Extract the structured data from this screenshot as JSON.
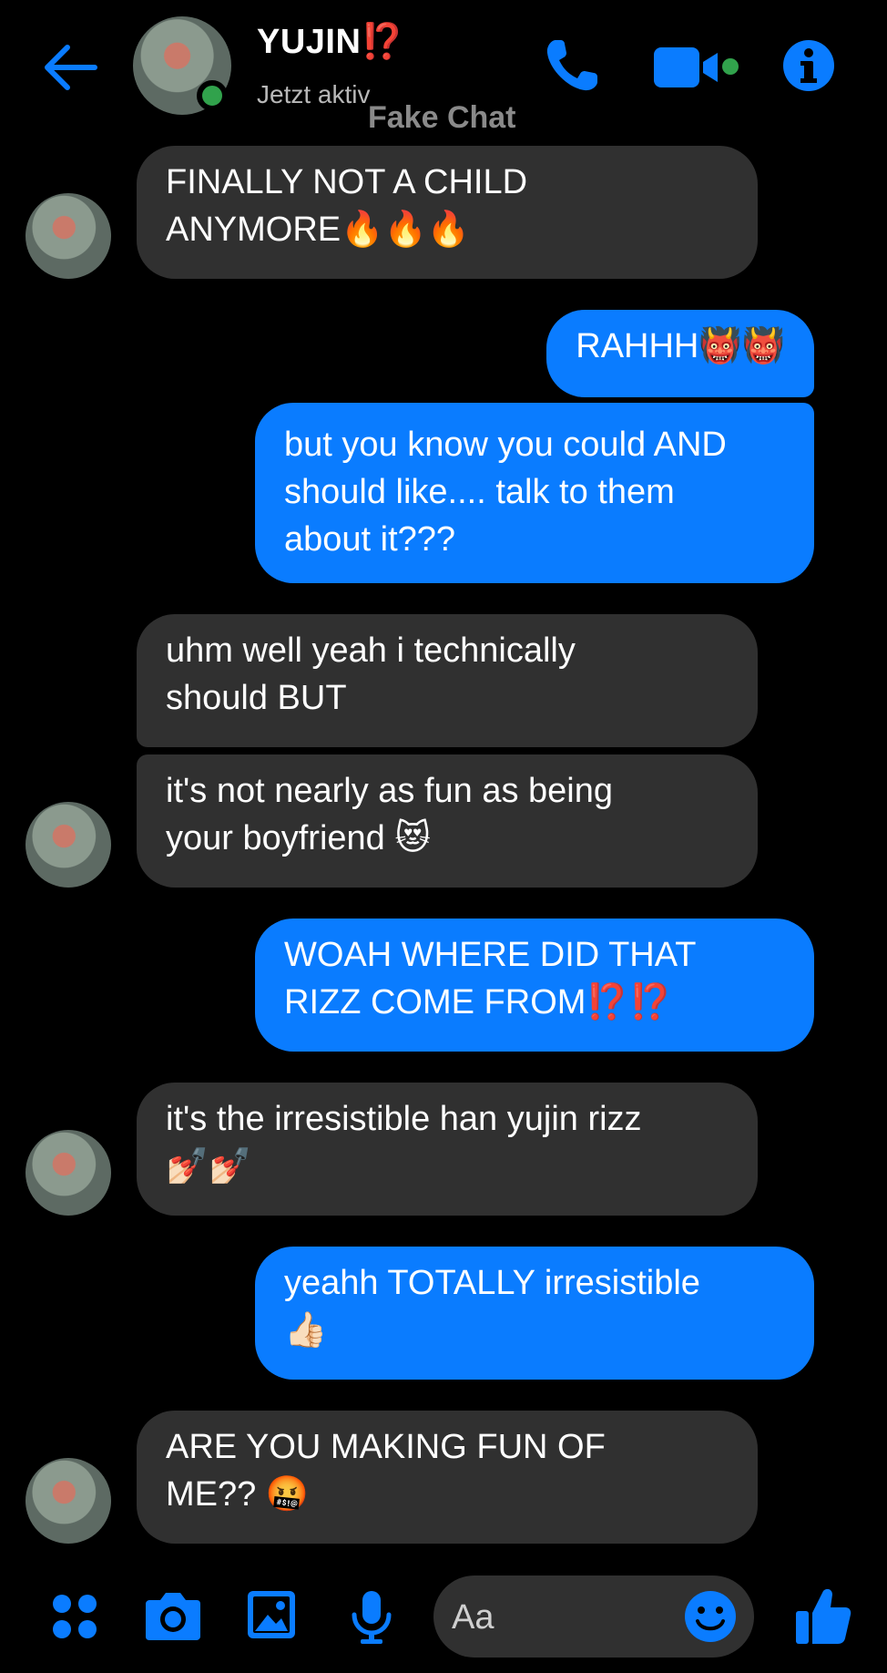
{
  "header": {
    "name": "YUJIN",
    "name_suffix": "⁉️",
    "status": "Jetzt aktiv",
    "watermark": "Fake Chat",
    "back_icon": "arrow-left-icon",
    "call_icon": "phone-icon",
    "video_icon": "video-camera-icon",
    "info_icon": "info-icon"
  },
  "colors": {
    "accent": "#0a7cff",
    "incoming_bubble": "#303030",
    "online": "#31a24c",
    "background": "#000000"
  },
  "messages": [
    {
      "dir": "in",
      "text": "FINALLY NOT A CHILD\nANYMORE🔥🔥🔥",
      "avatar": true
    },
    {
      "dir": "out",
      "text": "RAHHH👹👹"
    },
    {
      "dir": "out",
      "text": "but you know you could AND\nshould like.... talk to them\nabout it???"
    },
    {
      "dir": "in",
      "text": "uhm well yeah i technically\nshould BUT",
      "avatar": false
    },
    {
      "dir": "in",
      "text": "it's not nearly as fun as being\nyour boyfriend 😻",
      "avatar": true
    },
    {
      "dir": "out",
      "text": "WOAH WHERE DID THAT\nRIZZ COME FROM⁉️⁉️"
    },
    {
      "dir": "in",
      "text": "it's the irresistible han yujin rizz\n💅🏻💅🏻",
      "avatar": true
    },
    {
      "dir": "out",
      "text": "yeahh TOTALLY irresistible\n👍🏻"
    },
    {
      "dir": "in",
      "text": "ARE YOU MAKING FUN OF\nME?? 🤬",
      "avatar": true
    }
  ],
  "composer": {
    "placeholder": "Aa",
    "icons": [
      "apps-icon",
      "camera-icon",
      "image-icon",
      "microphone-icon",
      "emoji-icon",
      "like-icon"
    ]
  }
}
